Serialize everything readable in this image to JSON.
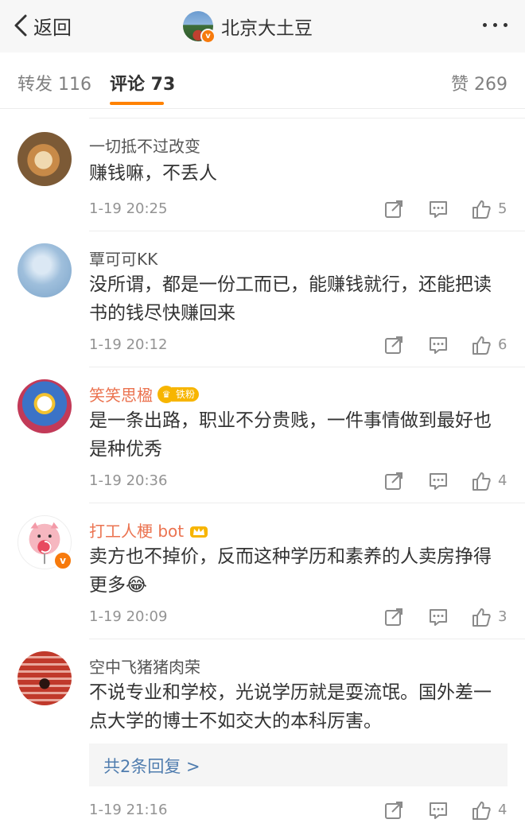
{
  "header": {
    "back_label": "返回",
    "title": "北京大土豆",
    "verified_mark": "v"
  },
  "tabs": {
    "repost": "转发 116",
    "comment": "评论 73",
    "like": "赞 269"
  },
  "comments": [
    {
      "user": "一切抵不过改变",
      "text": "赚钱嘛，不丢人",
      "time": "1-19 20:25",
      "likes": "5"
    },
    {
      "user": "覃可可KK",
      "text": "没所谓，都是一份工而已，能赚钱就行，还能把读书的钱尽快赚回来",
      "time": "1-19 20:12",
      "likes": "6"
    },
    {
      "user": "笑笑思楹",
      "badge": "铁粉",
      "text": "是一条出路，职业不分贵贱，一件事情做到最好也是种优秀",
      "time": "1-19 20:36",
      "likes": "4"
    },
    {
      "user": "打工人梗 bot",
      "text": "卖方也不掉价，反而这种学历和素养的人卖房挣得更多😂",
      "time": "1-19 20:09",
      "likes": "3"
    },
    {
      "user": "空中飞猪猪肉荣",
      "text": "不说专业和学校，光说学历就是耍流氓。国外差一点大学的博士不如交大的本科厉害。",
      "replies": "共2条回复 >",
      "time": "1-19 21:16",
      "likes": "4"
    }
  ],
  "colors": {
    "accent": "#ff8200",
    "username_vip": "#eb7350",
    "reply_link": "#507daf",
    "fan_badge": "#f7b500"
  }
}
